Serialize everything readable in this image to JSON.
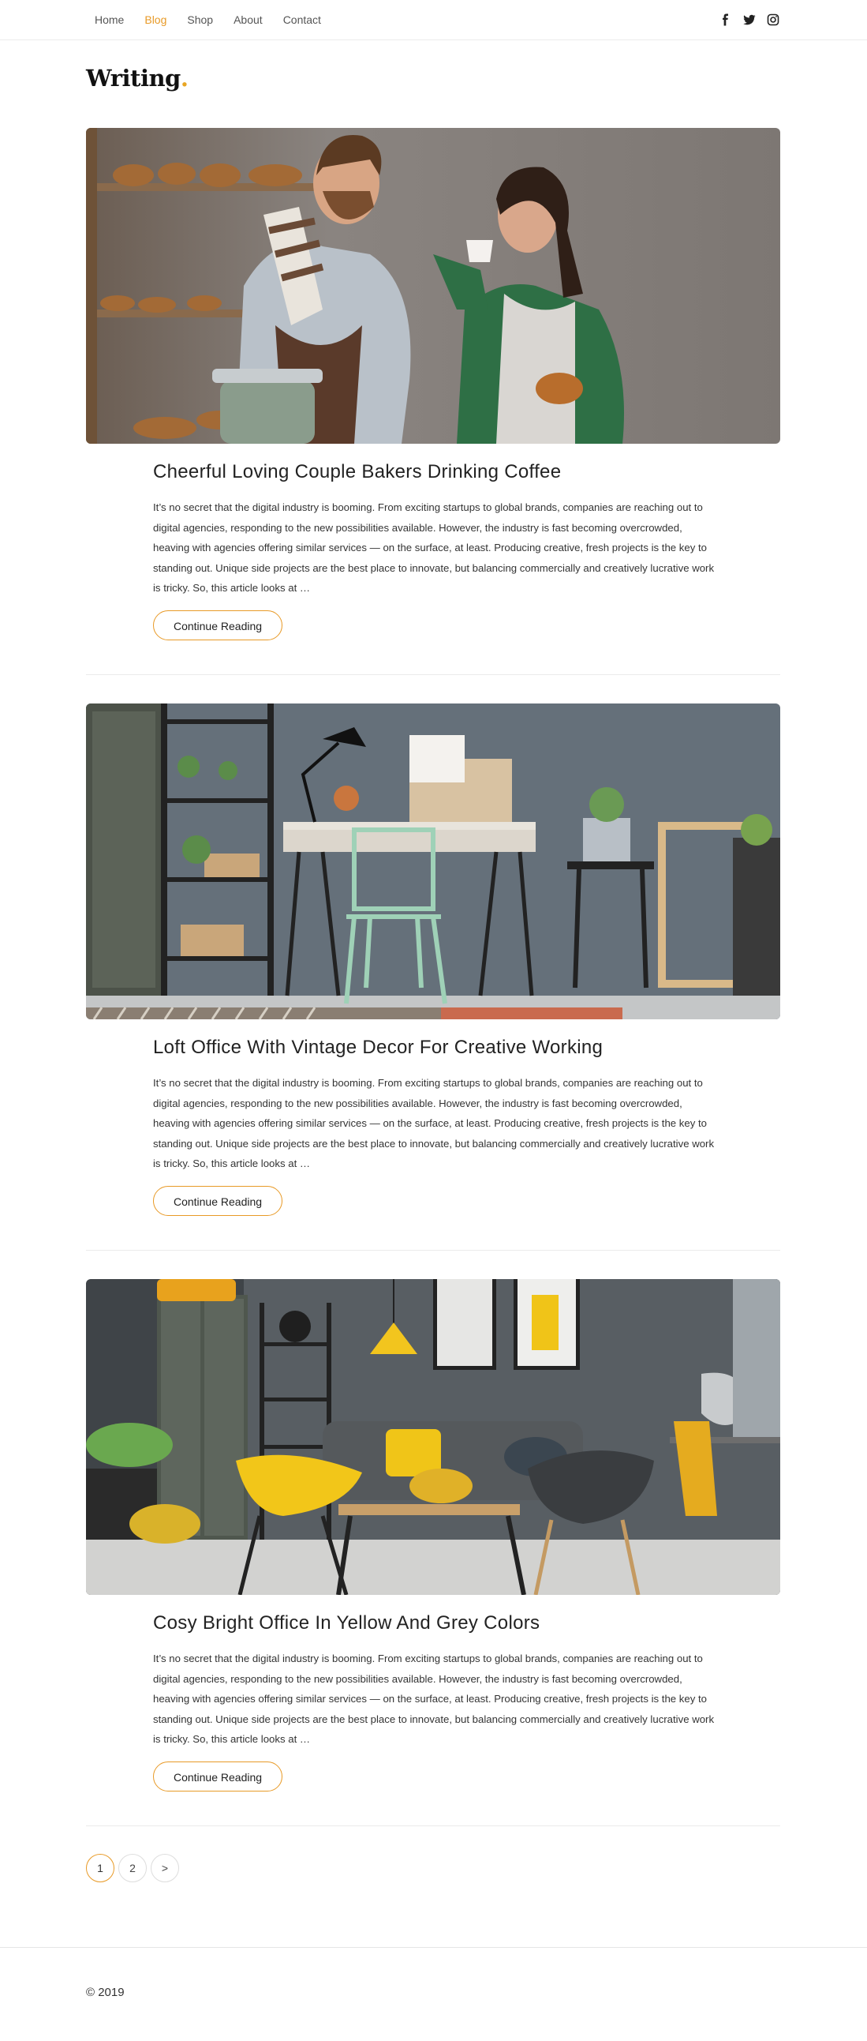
{
  "nav": {
    "items": [
      {
        "label": "Home",
        "active": false
      },
      {
        "label": "Blog",
        "active": true
      },
      {
        "label": "Shop",
        "active": false
      },
      {
        "label": "About",
        "active": false
      },
      {
        "label": "Contact",
        "active": false
      }
    ],
    "social_icons": [
      "facebook-icon",
      "twitter-icon",
      "instagram-icon"
    ]
  },
  "logo": {
    "text": "Writing",
    "dot": "."
  },
  "posts": [
    {
      "title": "Cheerful Loving Couple Bakers Drinking Coffee",
      "excerpt": "It’s no secret that the digital industry is booming. From exciting startups to global brands, companies are reaching out to digital agencies, responding to the new possibilities available. However, the industry is fast becoming overcrowded, heaving with agencies offering similar services — on the surface, at least. Producing creative, fresh projects is the key to standing out. Unique side projects are the best place to innovate, but balancing commercially and creatively lucrative work is tricky. So, this article looks at …",
      "button": "Continue Reading",
      "image": "bakers-photo"
    },
    {
      "title": "Loft Office With Vintage Decor For Creative Working",
      "excerpt": "It’s no secret that the digital industry is booming. From exciting startups to global brands, companies are reaching out to digital agencies, responding to the new possibilities available. However, the industry is fast becoming overcrowded, heaving with agencies offering similar services — on the surface, at least. Producing creative, fresh projects is the key to standing out. Unique side projects are the best place to innovate, but balancing commercially and creatively lucrative work is tricky. So, this article looks at …",
      "button": "Continue Reading",
      "image": "loft-office-photo"
    },
    {
      "title": "Cosy Bright Office In Yellow And Grey Colors",
      "excerpt": "It’s no secret that the digital industry is booming. From exciting startups to global brands, companies are reaching out to digital agencies, responding to the new possibilities available. However, the industry is fast becoming overcrowded, heaving with agencies offering similar services — on the surface, at least. Producing creative, fresh projects is the key to standing out. Unique side projects are the best place to innovate, but balancing commercially and creatively lucrative work is tricky. So, this article looks at …",
      "button": "Continue Reading",
      "image": "yellow-office-photo"
    }
  ],
  "pagination": {
    "pages": [
      "1",
      "2"
    ],
    "next": ">",
    "current": "1"
  },
  "footer": {
    "copyright": "© 2019"
  },
  "colors": {
    "accent": "#e89a27",
    "text": "#222222",
    "divider": "#ebebeb"
  }
}
